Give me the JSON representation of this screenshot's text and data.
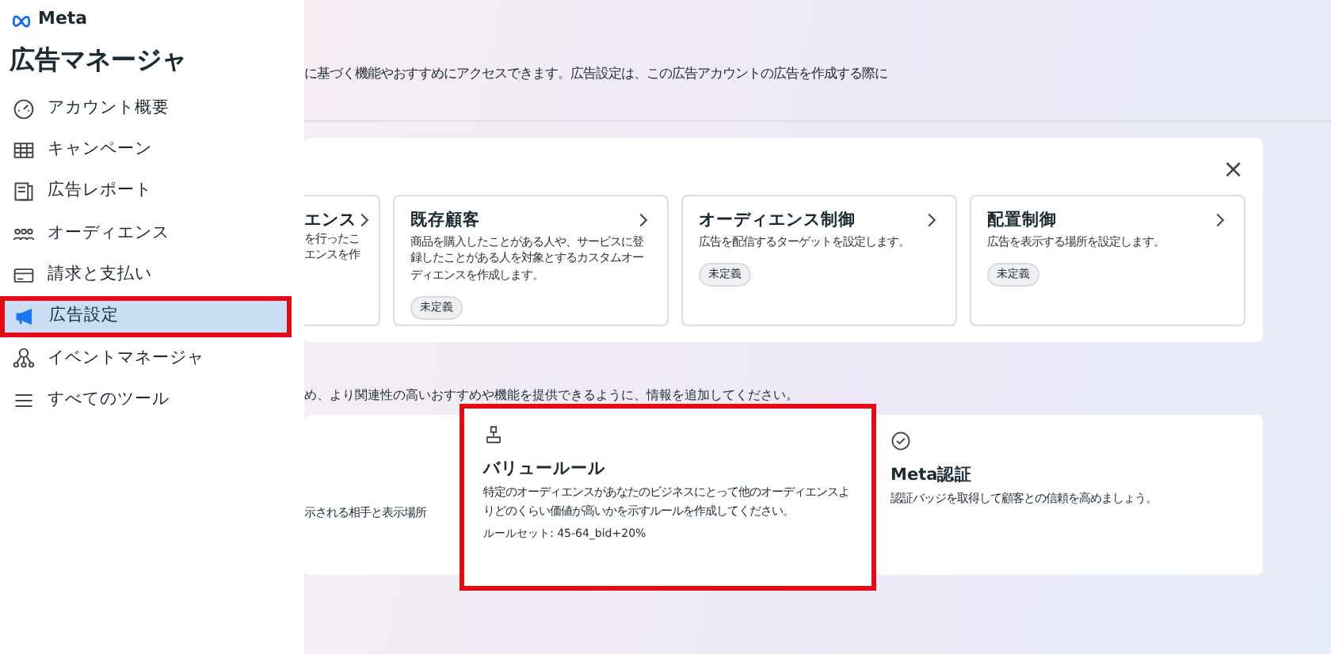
{
  "sidebar": {
    "brand": "Meta",
    "title": "広告マネージャ",
    "items": [
      {
        "label": "アカウント概要",
        "selected": false,
        "highlighted": false
      },
      {
        "label": "キャンペーン",
        "selected": false,
        "highlighted": false
      },
      {
        "label": "広告レポート",
        "selected": false,
        "highlighted": false
      },
      {
        "label": "オーディエンス",
        "selected": false,
        "highlighted": false
      },
      {
        "label": "請求と支払い",
        "selected": false,
        "highlighted": false
      },
      {
        "label": "広告設定",
        "selected": true,
        "highlighted": true
      },
      {
        "label": "イベントマネージャ",
        "selected": false,
        "highlighted": false
      },
      {
        "label": "すべてのツール",
        "selected": false,
        "highlighted": false
      }
    ]
  },
  "intro": "に基づく機能やおすすめにアクセスできます。広告設定は、この広告アカウントの広告を作成する際に",
  "audience_panel": {
    "close": "×",
    "cards": [
      {
        "title": "エンス",
        "description_lines": [
          "を行ったこ",
          "エンスを作"
        ]
      },
      {
        "title": "既存顧客",
        "description": "商品を購入したことがある人や、サービスに登録したことがある人を対象とするカスタムオーディエンスを作成します。",
        "status": "未定義"
      },
      {
        "title": "オーディエンス制御",
        "description": "広告を配信するターゲットを設定します。",
        "status": "未定義"
      },
      {
        "title": "配置制御",
        "description": "広告を表示する場所を設定します。",
        "status": "未定義"
      }
    ]
  },
  "section_text": "め、より関連性の高いおすすめや機能を提供できるように、情報を追加してください。",
  "feature_panel": {
    "cards": [
      {
        "kind": "partial",
        "description": "示される相手と表示場所",
        "highlighted": false
      },
      {
        "kind": "value",
        "title": "バリュールール",
        "description": "特定のオーディエンスがあなたのビジネスにとって他のオーディエンスよりどのくらい価値が高いかを示すルールを作成してください。",
        "detail": "ルールセット: 45-64_bid+20%",
        "highlighted": true
      },
      {
        "kind": "verify",
        "title": "Meta認証",
        "description": "認証バッジを取得して顧客との信頼を高めましょう。",
        "highlighted": false
      }
    ]
  }
}
